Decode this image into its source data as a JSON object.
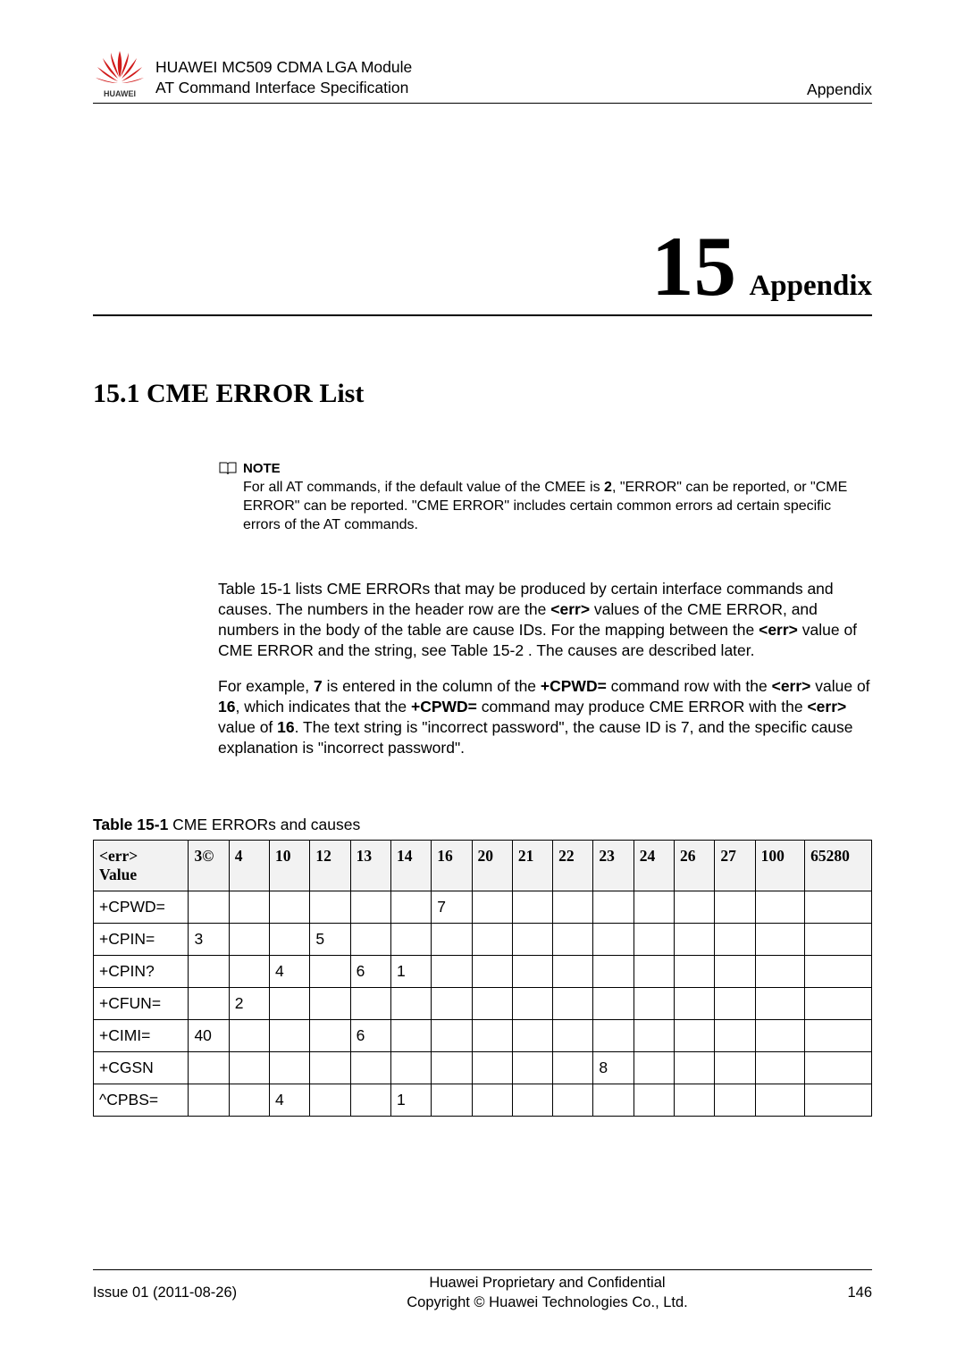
{
  "header": {
    "line1": "HUAWEI MC509 CDMA LGA Module",
    "line2": "AT Command Interface Specification",
    "right": "Appendix"
  },
  "chapter": {
    "number": "15",
    "title": "Appendix"
  },
  "section": {
    "number_title": "15.1 CME ERROR List"
  },
  "note": {
    "label": "NOTE",
    "text_pre": "For all AT commands, if the default value of the CMEE is ",
    "bold2": "2",
    "text_post": ", \"ERROR\" can be reported, or \"CME ERROR\" can be reported. \"CME ERROR\" includes certain common errors ad certain specific errors of the AT commands."
  },
  "paragraphs": {
    "p1a": "Table 15-1 lists CME ERRORs that may be produced by certain interface commands and causes. The numbers in the header row are the ",
    "p1b": "<err>",
    "p1c": " values of the CME ERROR, and numbers in the body of the table are cause IDs. For the mapping between the ",
    "p1d": "<err>",
    "p1e": " value of CME ERROR and the string, see Table 15-2 . The causes are described later.",
    "p2a": "For example, ",
    "p2b": "7",
    "p2c": " is entered in the column of the ",
    "p2d": "+CPWD=",
    "p2e": " command row with the ",
    "p2f": "<err>",
    "p2g": " value of ",
    "p2h": "16",
    "p2i": ", which indicates that the ",
    "p2j": "+CPWD=",
    "p2k": " command may produce CME ERROR with the ",
    "p2l": "<err>",
    "p2m": " value of ",
    "p2n": "16",
    "p2o": ". The text string is \"incorrect password\", the cause ID is 7, and the specific cause explanation is \"incorrect password\"."
  },
  "table": {
    "caption_label": "Table 15-1 ",
    "caption_text": " CME ERRORs and causes",
    "header_first_line1": "<err>",
    "header_first_line2": "Value",
    "headers": [
      "3©",
      "4",
      "10",
      "12",
      "13",
      "14",
      "16",
      "20",
      "21",
      "22",
      "23",
      "24",
      "26",
      "27",
      "100",
      "65280"
    ],
    "rows": [
      {
        "label": "+CPWD=",
        "cells": [
          "",
          "",
          "",
          "",
          "",
          "",
          "7",
          "",
          "",
          "",
          "",
          "",
          "",
          "",
          "",
          ""
        ]
      },
      {
        "label": "+CPIN=",
        "cells": [
          "3",
          "",
          "",
          "5",
          "",
          "",
          "",
          "",
          "",
          "",
          "",
          "",
          "",
          "",
          "",
          ""
        ]
      },
      {
        "label": "+CPIN?",
        "cells": [
          "",
          "",
          "4",
          "",
          "6",
          "1",
          "",
          "",
          "",
          "",
          "",
          "",
          "",
          "",
          "",
          ""
        ]
      },
      {
        "label": "+CFUN=",
        "cells": [
          "",
          "2",
          "",
          "",
          "",
          "",
          "",
          "",
          "",
          "",
          "",
          "",
          "",
          "",
          "",
          ""
        ]
      },
      {
        "label": "+CIMI=",
        "cells": [
          "40",
          "",
          "",
          "",
          "6",
          "",
          "",
          "",
          "",
          "",
          "",
          "",
          "",
          "",
          "",
          ""
        ]
      },
      {
        "label": "+CGSN",
        "cells": [
          "",
          "",
          "",
          "",
          "",
          "",
          "",
          "",
          "",
          "",
          "8",
          "",
          "",
          "",
          "",
          ""
        ]
      },
      {
        "label": "^CPBS=",
        "cells": [
          "",
          "",
          "4",
          "",
          "",
          "1",
          "",
          "",
          "",
          "",
          "",
          "",
          "",
          "",
          "",
          ""
        ]
      }
    ]
  },
  "footer": {
    "left": "Issue 01 (2011-08-26)",
    "center1": "Huawei Proprietary and Confidential",
    "center2": "Copyright © Huawei Technologies Co., Ltd.",
    "right": "146"
  }
}
